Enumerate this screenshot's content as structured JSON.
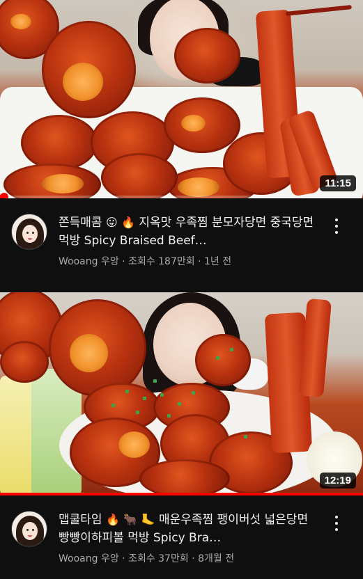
{
  "colors": {
    "background": "#0f0f0f",
    "title": "#f1f1f1",
    "subtitle": "#aaaaaa",
    "progress": "#ff0000",
    "badge_bg": "#000000"
  },
  "videos": [
    {
      "duration": "11:15",
      "progress_fraction": 0.02,
      "title_text": "쫀득매콤",
      "title_emojis": [
        "😛",
        "🔥"
      ],
      "title_rest": " 지옥맛 우족찜 분모자당면 중국당면 먹방 Spicy Braised Beef…",
      "channel": "Wooang 우앙",
      "views": "조회수 187만회",
      "age": "1년 전",
      "separator": "·",
      "menu_icon": "more-vert-icon"
    },
    {
      "duration": "12:19",
      "progress_fraction": 1.0,
      "title_text": "맵쿨타임",
      "title_emojis": [
        "🔥",
        "🐂",
        "🦶"
      ],
      "title_rest": " 매운우족찜 팽이버섯 넓은당면 빵빵이하피볼 먹방 Spicy Bra…",
      "channel": "Wooang 우앙",
      "views": "조회수 37만회",
      "age": "8개월 전",
      "separator": "·",
      "menu_icon": "more-vert-icon"
    }
  ]
}
